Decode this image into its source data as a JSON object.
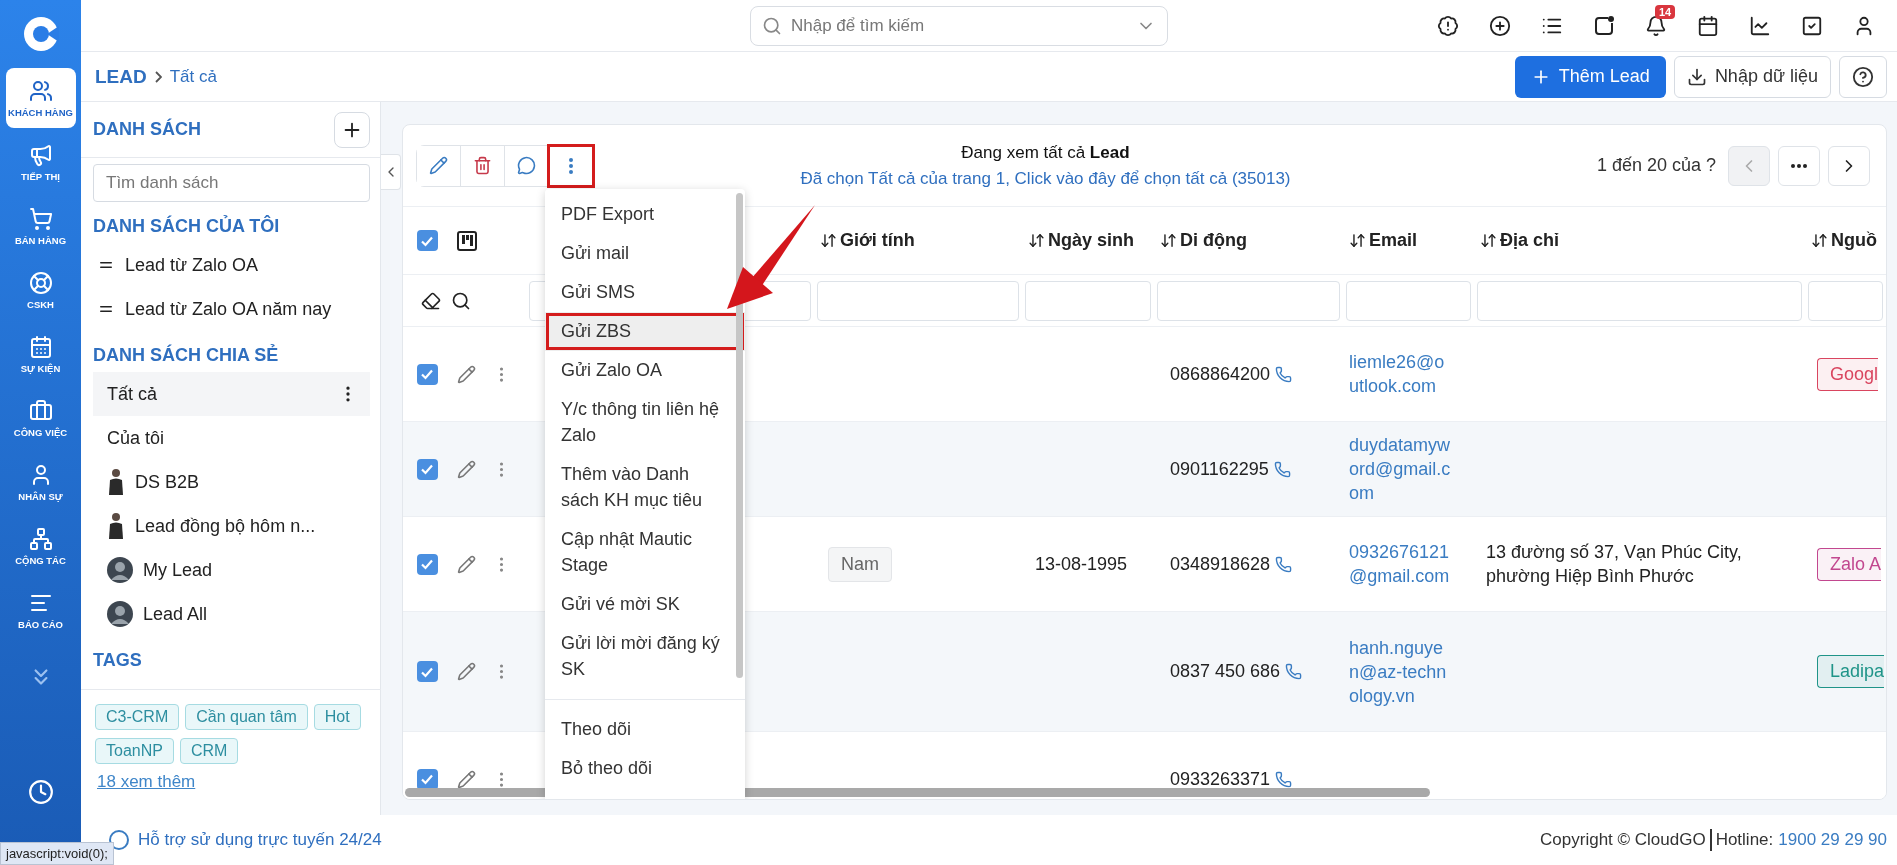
{
  "nav": {
    "items": [
      {
        "label": "KHÁCH HÀNG",
        "selected": true
      },
      {
        "label": "TIẾP THỊ",
        "selected": false
      },
      {
        "label": "BÁN HÀNG",
        "selected": false
      },
      {
        "label": "CSKH",
        "selected": false
      },
      {
        "label": "SỰ KIỆN",
        "selected": false
      },
      {
        "label": "CÔNG VIỆC",
        "selected": false
      },
      {
        "label": "NHÂN SỰ",
        "selected": false
      },
      {
        "label": "CỘNG TÁC",
        "selected": false
      },
      {
        "label": "BÁO CÁO",
        "selected": false
      }
    ]
  },
  "topbar": {
    "search": {
      "placeholder": "Nhập để tìm kiếm"
    },
    "notification_count": "14"
  },
  "breadcrumb": {
    "module": "LEAD",
    "current": "Tất cả"
  },
  "actions": {
    "primary": "Thêm Lead",
    "import": "Nhập dữ liệu"
  },
  "sidebar": {
    "title": "DANH SÁCH",
    "search": {
      "placeholder": "Tìm danh sách"
    },
    "sections": [
      {
        "title": "DANH SÁCH CỦA TÔI",
        "items": [
          {
            "label": "Lead từ Zalo OA",
            "kind": "handle",
            "selected": false
          },
          {
            "label": "Lead từ Zalo OA năm nay",
            "kind": "handle",
            "selected": false
          }
        ]
      },
      {
        "title": "DANH SÁCH CHIA SẺ",
        "items": [
          {
            "label": "Tất cả",
            "kind": "plain",
            "selected": true
          },
          {
            "label": "Của tôi",
            "kind": "plain",
            "selected": false
          },
          {
            "label": "DS B2B",
            "kind": "person",
            "selected": false
          },
          {
            "label": "Lead đồng bộ hôm n...",
            "kind": "person",
            "selected": false
          },
          {
            "label": "My Lead",
            "kind": "avatar",
            "selected": false
          },
          {
            "label": "Lead All",
            "kind": "avatar",
            "selected": false
          }
        ]
      }
    ],
    "tags_title": "TAGS",
    "tags": [
      "C3-CRM",
      "Cần quan tâm",
      "Hot",
      "ToanNP",
      "CRM"
    ],
    "more_link": "18 xem thêm"
  },
  "card": {
    "summary": "Đang xem tất cả **Lead**",
    "select_all_link": "Đã chọn Tất cả của trang 1, Click vào đây để chọn tất cả (35013)",
    "pager": "1 đến 20 của ?",
    "more_button_annotated": true
  },
  "table": {
    "all_selected": true,
    "columns": [
      "Giới tính",
      "Ngày sinh",
      "Di động",
      "Email",
      "Địa chỉ",
      "Nguồ"
    ],
    "rows": [
      {
        "selected": true,
        "mobile": "0868864200",
        "email": "liemle26@outlook.com",
        "source": {
          "label": "Googl",
          "color": "#d9455f"
        }
      },
      {
        "selected": true,
        "mobile": "0901162295",
        "email": "duydatamyword@gmail.com"
      },
      {
        "selected": true,
        "gender": "Nam",
        "birthday": "13-08-1995",
        "mobile": "0348918628",
        "email": "0932676121@gmail.com",
        "address": "13 đường số 37, Vạn Phúc City, phường Hiệp Bình Phước",
        "source": {
          "label": "Zalo A",
          "color": "#c2478f"
        }
      },
      {
        "selected": true,
        "mobile": "0837 450 686",
        "email": "hanh.nguyen@az-technology.vn",
        "source": {
          "label": "Ladipa",
          "color": "#1f9488"
        }
      },
      {
        "selected": true,
        "mobile": "0933263371"
      }
    ]
  },
  "menu": {
    "groups": [
      [
        {
          "label": "PDF Export",
          "selected": false
        },
        {
          "label": "Gửi mail",
          "selected": false
        },
        {
          "label": "Gửi SMS",
          "selected": false
        },
        {
          "label": "Gửi ZBS",
          "selected": true
        },
        {
          "label": "Gửi Zalo OA",
          "selected": false
        },
        {
          "label": "Y/c thông tin liên hệ Zalo",
          "selected": false
        },
        {
          "label": "Thêm vào Danh sách KH mục tiêu",
          "selected": false
        },
        {
          "label": "Cập nhật Mautic Stage",
          "selected": false
        },
        {
          "label": "Gửi vé mời SK",
          "selected": false
        },
        {
          "label": "Gửi lời mời đăng ký SK",
          "selected": false
        }
      ],
      [
        {
          "label": "Theo dõi",
          "selected": false
        },
        {
          "label": "Bỏ theo dõi",
          "selected": false
        }
      ]
    ]
  },
  "footer": {
    "support": "Hỗ trợ sử dụng trực tuyến 24/24",
    "copyright": "Copyright © CloudGO",
    "hotline_label": "Hotline:",
    "hotline": "1900 29 29 90"
  },
  "status_tooltip": "javascript:void(0);"
}
